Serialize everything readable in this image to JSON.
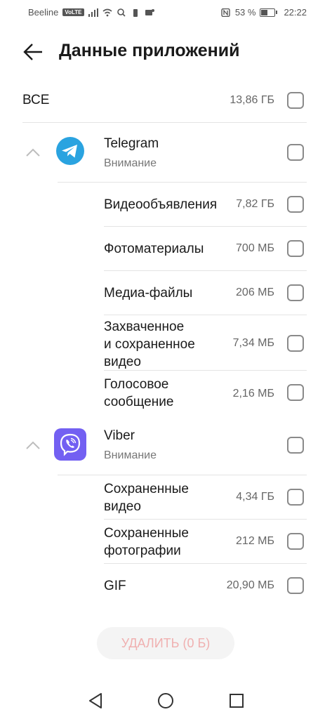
{
  "status_bar": {
    "carrier": "Beeline",
    "volte": "VoLTE",
    "battery_percent": "53 %",
    "time": "22:22",
    "battery_level": 0.53
  },
  "header": {
    "title": "Данные приложений"
  },
  "all_row": {
    "label": "ВСЕ",
    "size": "13,86 ГБ"
  },
  "apps": [
    {
      "name": "Telegram",
      "status": "Внимание",
      "items": [
        {
          "label": "Видеообъявления",
          "size": "7,82 ГБ"
        },
        {
          "label": "Фотоматериалы",
          "size": "700 МБ"
        },
        {
          "label": "Медиа-файлы",
          "size": "206 МБ"
        },
        {
          "label_lines": [
            "Захваченное",
            "и сохраненное",
            "видео"
          ],
          "size": "7,34 МБ"
        },
        {
          "label_lines": [
            "Голосовое",
            "сообщение"
          ],
          "size": "2,16 МБ"
        }
      ]
    },
    {
      "name": "Viber",
      "status": "Внимание",
      "items": [
        {
          "label_lines": [
            "Сохраненные",
            "видео"
          ],
          "size": "4,34 ГБ"
        },
        {
          "label_lines": [
            "Сохраненные",
            "фотографии"
          ],
          "size": "212 МБ"
        },
        {
          "label": "GIF",
          "size": "20,90 МБ"
        }
      ]
    }
  ],
  "delete_button": {
    "label": "УДАЛИТЬ (0 Б)"
  },
  "colors": {
    "telegram": "#2aa3e0",
    "viber": "#7360f2",
    "delete_text": "#f0b0b0"
  }
}
